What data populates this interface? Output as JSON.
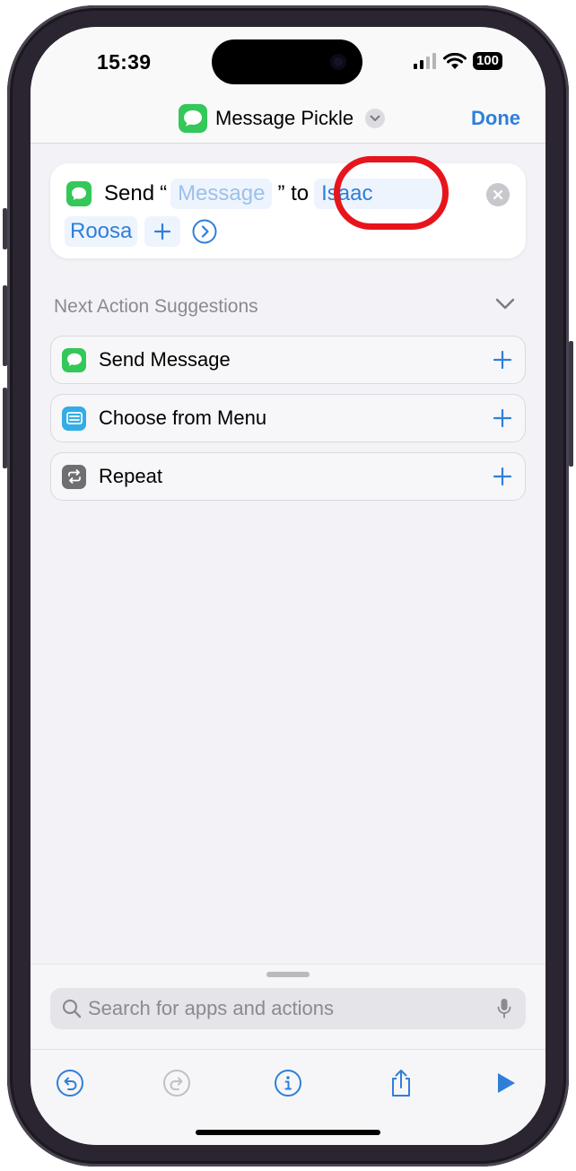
{
  "status_bar": {
    "time": "15:39",
    "battery": "100"
  },
  "navbar": {
    "title": "Message Pickle",
    "done_label": "Done"
  },
  "action": {
    "verb": "Send",
    "open_quote": "“",
    "message_placeholder": "Message",
    "close_quote_to": "” to",
    "recipient_first": "Isaac",
    "recipient_last": "Roosa"
  },
  "suggestions": {
    "header": "Next Action Suggestions",
    "items": [
      {
        "label": "Send Message",
        "icon": "messages-icon",
        "color": "#34c759"
      },
      {
        "label": "Choose from Menu",
        "icon": "menu-icon",
        "color": "#32ade6"
      },
      {
        "label": "Repeat",
        "icon": "repeat-icon",
        "color": "#6e6e73"
      }
    ]
  },
  "search": {
    "placeholder": "Search for apps and actions"
  },
  "toolbar": {
    "buttons": [
      "undo-icon",
      "redo-icon",
      "info-icon",
      "share-icon",
      "play-icon"
    ]
  },
  "colors": {
    "accent": "#2f7fd8",
    "messages_green": "#34c759",
    "highlight_red": "#e8141c"
  }
}
